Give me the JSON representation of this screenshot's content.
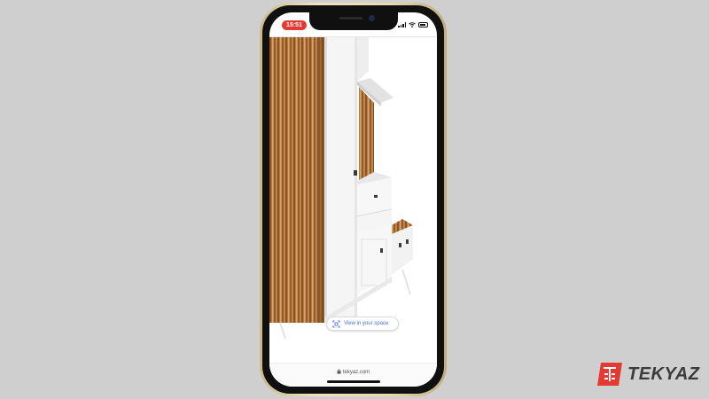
{
  "status_bar": {
    "time": "15:51"
  },
  "viewer": {
    "ar_button_label": "View in your space",
    "ar_icon": "ar-view-icon"
  },
  "address_bar": {
    "url": "tekyaz.com",
    "lock_icon": "lock-icon"
  },
  "watermark": {
    "brand": "TEKYAZ",
    "logo_icon": "tekyaz-logo-icon",
    "accent": "#e53a34"
  },
  "colors": {
    "status_time_bg": "#e53a34",
    "wood": "#b77a3e",
    "cabinet_white": "#f4f4f4"
  }
}
